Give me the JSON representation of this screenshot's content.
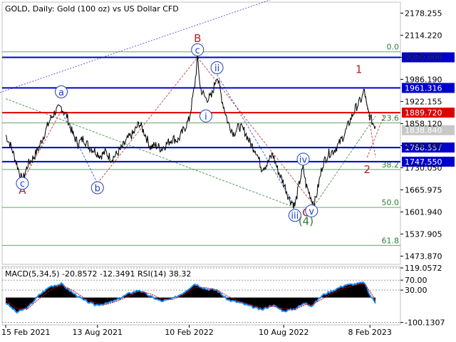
{
  "chart_data": {
    "type": "line",
    "title": "GOLD, Daily:  Gold (100 oz) vs US Dollar CFD",
    "price_axis": {
      "ticks": [
        "2178.255",
        "2114.220",
        "2050.000",
        "1986.190",
        "1922.155",
        "1858.120",
        "1794.085",
        "1730.050",
        "1665.975",
        "1601.940",
        "1537.905",
        "1473.870"
      ],
      "range": [
        1450,
        2210
      ]
    },
    "time_axis": {
      "ticks": [
        "15 Feb 2021",
        "13 Aug 2021",
        "10 Feb 2022",
        "10 Aug 2022",
        "8 Feb 2023"
      ]
    },
    "price_series": [
      {
        "t": 0,
        "p": 1825
      },
      {
        "t": 2,
        "p": 1790
      },
      {
        "t": 4,
        "p": 1740
      },
      {
        "t": 6,
        "p": 1690
      },
      {
        "t": 8,
        "p": 1740
      },
      {
        "t": 10,
        "p": 1760
      },
      {
        "t": 12,
        "p": 1790
      },
      {
        "t": 14,
        "p": 1830
      },
      {
        "t": 16,
        "p": 1870
      },
      {
        "t": 18,
        "p": 1895
      },
      {
        "t": 20,
        "p": 1905
      },
      {
        "t": 22,
        "p": 1880
      },
      {
        "t": 24,
        "p": 1830
      },
      {
        "t": 26,
        "p": 1800
      },
      {
        "t": 28,
        "p": 1815
      },
      {
        "t": 30,
        "p": 1790
      },
      {
        "t": 32,
        "p": 1780
      },
      {
        "t": 34,
        "p": 1765
      },
      {
        "t": 36,
        "p": 1775
      },
      {
        "t": 38,
        "p": 1755
      },
      {
        "t": 40,
        "p": 1770
      },
      {
        "t": 42,
        "p": 1790
      },
      {
        "t": 44,
        "p": 1815
      },
      {
        "t": 46,
        "p": 1830
      },
      {
        "t": 48,
        "p": 1860
      },
      {
        "t": 50,
        "p": 1830
      },
      {
        "t": 52,
        "p": 1790
      },
      {
        "t": 54,
        "p": 1795
      },
      {
        "t": 56,
        "p": 1785
      },
      {
        "t": 58,
        "p": 1800
      },
      {
        "t": 60,
        "p": 1815
      },
      {
        "t": 62,
        "p": 1810
      },
      {
        "t": 64,
        "p": 1840
      },
      {
        "t": 66,
        "p": 1870
      },
      {
        "t": 67,
        "p": 1920
      },
      {
        "t": 68,
        "p": 1970
      },
      {
        "t": 69,
        "p": 2050
      },
      {
        "t": 70,
        "p": 1960
      },
      {
        "t": 72,
        "p": 1930
      },
      {
        "t": 74,
        "p": 1935
      },
      {
        "t": 76,
        "p": 2000
      },
      {
        "t": 78,
        "p": 1920
      },
      {
        "t": 80,
        "p": 1860
      },
      {
        "t": 82,
        "p": 1830
      },
      {
        "t": 84,
        "p": 1850
      },
      {
        "t": 86,
        "p": 1835
      },
      {
        "t": 88,
        "p": 1800
      },
      {
        "t": 90,
        "p": 1780
      },
      {
        "t": 92,
        "p": 1730
      },
      {
        "t": 94,
        "p": 1740
      },
      {
        "t": 96,
        "p": 1770
      },
      {
        "t": 98,
        "p": 1720
      },
      {
        "t": 100,
        "p": 1685
      },
      {
        "t": 102,
        "p": 1640
      },
      {
        "t": 104,
        "p": 1620
      },
      {
        "t": 106,
        "p": 1700
      },
      {
        "t": 107,
        "p": 1730
      },
      {
        "t": 108,
        "p": 1680
      },
      {
        "t": 110,
        "p": 1640
      },
      {
        "t": 111,
        "p": 1625
      },
      {
        "t": 112,
        "p": 1660
      },
      {
        "t": 114,
        "p": 1740
      },
      {
        "t": 116,
        "p": 1770
      },
      {
        "t": 118,
        "p": 1780
      },
      {
        "t": 120,
        "p": 1800
      },
      {
        "t": 122,
        "p": 1830
      },
      {
        "t": 124,
        "p": 1870
      },
      {
        "t": 126,
        "p": 1905
      },
      {
        "t": 128,
        "p": 1930
      },
      {
        "t": 129,
        "p": 1955
      },
      {
        "t": 130,
        "p": 1900
      },
      {
        "t": 131,
        "p": 1880
      },
      {
        "t": 132,
        "p": 1860
      },
      {
        "t": 133,
        "p": 1850
      }
    ],
    "horizontal_levels": [
      {
        "price": 2050.0,
        "label": "2050.000",
        "color": "#0000cc"
      },
      {
        "price": 1961.316,
        "label": "1961.316",
        "color": "#0000cc"
      },
      {
        "price": 1889.72,
        "label": "1889.720",
        "color": "#e00000"
      },
      {
        "price": 1788.557,
        "label": "1788.557",
        "color": "#0000cc"
      },
      {
        "price": 1747.55,
        "label": "1747.550",
        "color": "#0000cc"
      }
    ],
    "last_price": {
      "value": "1838.840"
    },
    "fib_levels": [
      {
        "price": 2066,
        "label": "0.0"
      },
      {
        "price": 1860,
        "label": "23.6"
      },
      {
        "price": 1725,
        "label": "38.2"
      },
      {
        "price": 1615,
        "label": "50.0"
      },
      {
        "price": 1505,
        "label": "61.8"
      }
    ],
    "wave_labels": [
      {
        "label": "A",
        "t": 6,
        "p": 1665,
        "color": "#b22222",
        "circled": false
      },
      {
        "label": "c",
        "t": 6,
        "p": 1685,
        "color": "#1f3fbf",
        "circled": true
      },
      {
        "label": "a",
        "t": 20,
        "p": 1950,
        "color": "#1f3fbf",
        "circled": true
      },
      {
        "label": "b",
        "t": 33,
        "p": 1672,
        "color": "#1f3fbf",
        "circled": true
      },
      {
        "label": "B",
        "t": 69,
        "p": 2105,
        "color": "#b22222",
        "circled": false
      },
      {
        "label": "c",
        "t": 69,
        "p": 2072,
        "color": "#1f3fbf",
        "circled": true
      },
      {
        "label": "ii",
        "t": 76,
        "p": 2020,
        "color": "#1f3fbf",
        "circled": true
      },
      {
        "label": "i",
        "t": 72,
        "p": 1880,
        "color": "#1f3fbf",
        "circled": true
      },
      {
        "label": "iv",
        "t": 107,
        "p": 1755,
        "color": "#1f3fbf",
        "circled": true
      },
      {
        "label": "iii",
        "t": 104,
        "p": 1592,
        "color": "#1f3fbf",
        "circled": true
      },
      {
        "label": "C",
        "t": 108,
        "p": 1600,
        "color": "#b22222",
        "circled": false
      },
      {
        "label": "v",
        "t": 110,
        "p": 1605,
        "color": "#1f3fbf",
        "circled": true
      },
      {
        "label": "(4)",
        "t": 108,
        "p": 1575,
        "color": "#2e7d32",
        "circled": false
      },
      {
        "label": "1",
        "t": 127,
        "p": 2015,
        "color": "#b22222",
        "circled": false
      },
      {
        "label": "2",
        "t": 130,
        "p": 1725,
        "color": "#b22222",
        "circled": false
      }
    ],
    "macd_panel": {
      "title": "MACD(5,34,5) -20.8572 -12.3491 RSI(14) 38.32",
      "ticks": [
        "119.0572",
        "70.00",
        "30.00",
        "-100.1307"
      ],
      "range": [
        -110,
        125
      ],
      "macd": [
        {
          "t": 0,
          "v": -20
        },
        {
          "t": 4,
          "v": -60
        },
        {
          "t": 8,
          "v": -40
        },
        {
          "t": 12,
          "v": 10
        },
        {
          "t": 16,
          "v": 45
        },
        {
          "t": 20,
          "v": 55
        },
        {
          "t": 24,
          "v": 20
        },
        {
          "t": 28,
          "v": -10
        },
        {
          "t": 32,
          "v": -30
        },
        {
          "t": 36,
          "v": -25
        },
        {
          "t": 40,
          "v": -10
        },
        {
          "t": 44,
          "v": 15
        },
        {
          "t": 48,
          "v": 30
        },
        {
          "t": 52,
          "v": 5
        },
        {
          "t": 56,
          "v": -15
        },
        {
          "t": 60,
          "v": -5
        },
        {
          "t": 64,
          "v": 20
        },
        {
          "t": 68,
          "v": 55
        },
        {
          "t": 72,
          "v": 35
        },
        {
          "t": 76,
          "v": 30
        },
        {
          "t": 80,
          "v": -10
        },
        {
          "t": 84,
          "v": -20
        },
        {
          "t": 88,
          "v": -35
        },
        {
          "t": 92,
          "v": -50
        },
        {
          "t": 96,
          "v": -30
        },
        {
          "t": 100,
          "v": -55
        },
        {
          "t": 104,
          "v": -45
        },
        {
          "t": 108,
          "v": -20
        },
        {
          "t": 110,
          "v": -35
        },
        {
          "t": 114,
          "v": 10
        },
        {
          "t": 118,
          "v": 30
        },
        {
          "t": 122,
          "v": 50
        },
        {
          "t": 126,
          "v": 55
        },
        {
          "t": 129,
          "v": 60
        },
        {
          "t": 131,
          "v": 10
        },
        {
          "t": 133,
          "v": -21
        }
      ],
      "signal": [
        {
          "t": 0,
          "v": -10
        },
        {
          "t": 4,
          "v": -45
        },
        {
          "t": 8,
          "v": -45
        },
        {
          "t": 12,
          "v": -5
        },
        {
          "t": 16,
          "v": 30
        },
        {
          "t": 20,
          "v": 50
        },
        {
          "t": 24,
          "v": 30
        },
        {
          "t": 28,
          "v": 0
        },
        {
          "t": 32,
          "v": -20
        },
        {
          "t": 36,
          "v": -28
        },
        {
          "t": 40,
          "v": -15
        },
        {
          "t": 44,
          "v": 5
        },
        {
          "t": 48,
          "v": 25
        },
        {
          "t": 52,
          "v": 15
        },
        {
          "t": 56,
          "v": -5
        },
        {
          "t": 60,
          "v": -8
        },
        {
          "t": 64,
          "v": 10
        },
        {
          "t": 68,
          "v": 40
        },
        {
          "t": 72,
          "v": 40
        },
        {
          "t": 76,
          "v": 30
        },
        {
          "t": 80,
          "v": 5
        },
        {
          "t": 84,
          "v": -15
        },
        {
          "t": 88,
          "v": -28
        },
        {
          "t": 92,
          "v": -42
        },
        {
          "t": 96,
          "v": -35
        },
        {
          "t": 100,
          "v": -45
        },
        {
          "t": 104,
          "v": -48
        },
        {
          "t": 108,
          "v": -28
        },
        {
          "t": 110,
          "v": -30
        },
        {
          "t": 114,
          "v": -5
        },
        {
          "t": 118,
          "v": 20
        },
        {
          "t": 122,
          "v": 40
        },
        {
          "t": 126,
          "v": 50
        },
        {
          "t": 129,
          "v": 55
        },
        {
          "t": 131,
          "v": 25
        },
        {
          "t": 133,
          "v": -12
        }
      ]
    },
    "colors": {
      "price_line": "#000000",
      "support_resistance": "#0000cc",
      "key_level": "#e00000",
      "fib": "#2e7d32",
      "wave_minor": "#1f3fbf",
      "wave_major": "#b22222",
      "last_price_tag": "#c8c8c8",
      "macd_line": "#1e90ff",
      "signal_line": "#e00000"
    }
  }
}
